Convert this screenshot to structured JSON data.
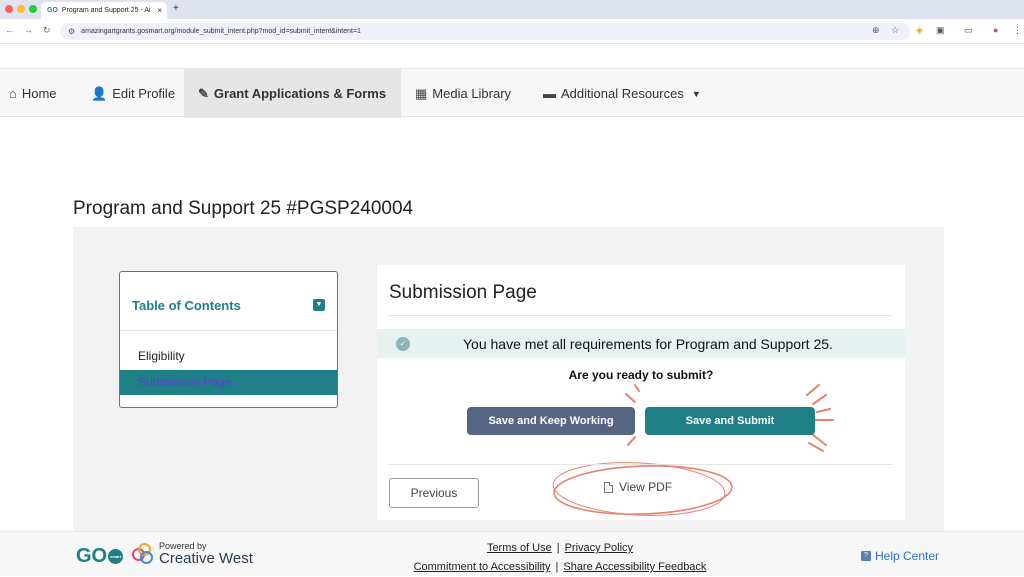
{
  "browser": {
    "tab_title": "Program and Support 25 - Ai",
    "tab_favicon": "GO",
    "url": "amazingartgrants.gosmart.org/module_submit_intent.php?mod_id=submit_intent&intent=1"
  },
  "nav": {
    "items": [
      {
        "label": "Home",
        "icon": "home-icon"
      },
      {
        "label": "Edit Profile",
        "icon": "user-icon"
      },
      {
        "label": "Grant Applications & Forms",
        "icon": "edit-icon",
        "active": true
      },
      {
        "label": "Media Library",
        "icon": "media-icon"
      },
      {
        "label": "Additional Resources",
        "icon": "folder-icon",
        "dropdown": true
      }
    ]
  },
  "page": {
    "title": "Program and Support 25 #PGSP240004"
  },
  "toc": {
    "title": "Table of Contents",
    "items": [
      "Eligibility",
      "Submission Page"
    ]
  },
  "submission": {
    "title": "Submission Page",
    "met_message": "You have met all requirements for Program and Support 25.",
    "question": "Are you ready to submit?",
    "save_keep_label": "Save and Keep Working",
    "save_submit_label": "Save and Submit",
    "previous_label": "Previous",
    "view_pdf_label": "View PDF",
    "pdf_icon_label": "PDF"
  },
  "footer": {
    "logo": "GO",
    "logo_sub": "smart",
    "powered_by": "Powered by",
    "partner": "Creative West",
    "links": [
      "Terms of Use",
      "Privacy Policy",
      "Commitment to Accessibility",
      "Share Accessibility Feedback"
    ],
    "help_label": "Help Center"
  },
  "colors": {
    "accent": "#1f7f86",
    "secondary_button": "#556582",
    "annotation": "#e8826f",
    "link": "#2a6fc9"
  }
}
